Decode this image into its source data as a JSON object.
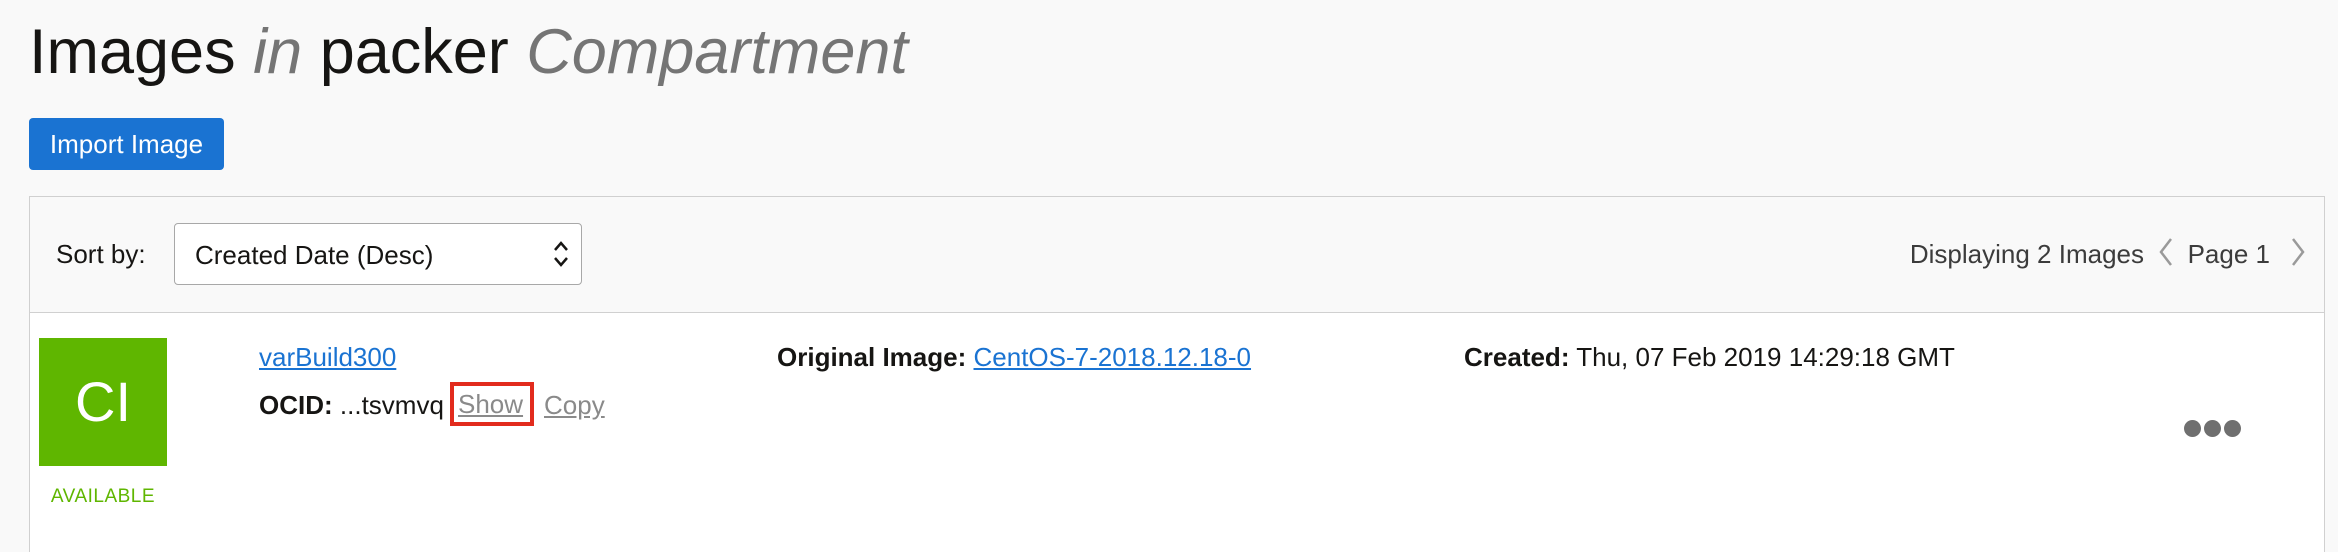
{
  "page_title": {
    "resource": "Images",
    "connector": "in",
    "compartment_name": "packer",
    "compartment_word": "Compartment"
  },
  "toolbar": {
    "import_label": "Import Image"
  },
  "list": {
    "sort_label": "Sort by:",
    "sort_value": "Created Date (Desc)",
    "display_count_text": "Displaying 2 Images",
    "page_label": "Page 1"
  },
  "image": {
    "initials": "CI",
    "status": "AVAILABLE",
    "name": "varBuild300",
    "ocid_label": "OCID:",
    "ocid_value": "...tsvmvq",
    "show_label": "Show",
    "copy_label": "Copy",
    "original_label": "Original Image:",
    "original_value": "CentOS-7-2018.12.18-0",
    "created_label": "Created:",
    "created_value": "Thu, 07 Feb 2019 14:29:18 GMT"
  },
  "colors": {
    "accent_blue": "#1a73d2",
    "available_green": "#5fb600",
    "highlight_red": "#e22b1d"
  },
  "icons": {
    "sort": "up-down-chevron-icon",
    "prev": "chevron-left-icon",
    "next": "chevron-right-icon",
    "more": "more-actions-icon"
  }
}
